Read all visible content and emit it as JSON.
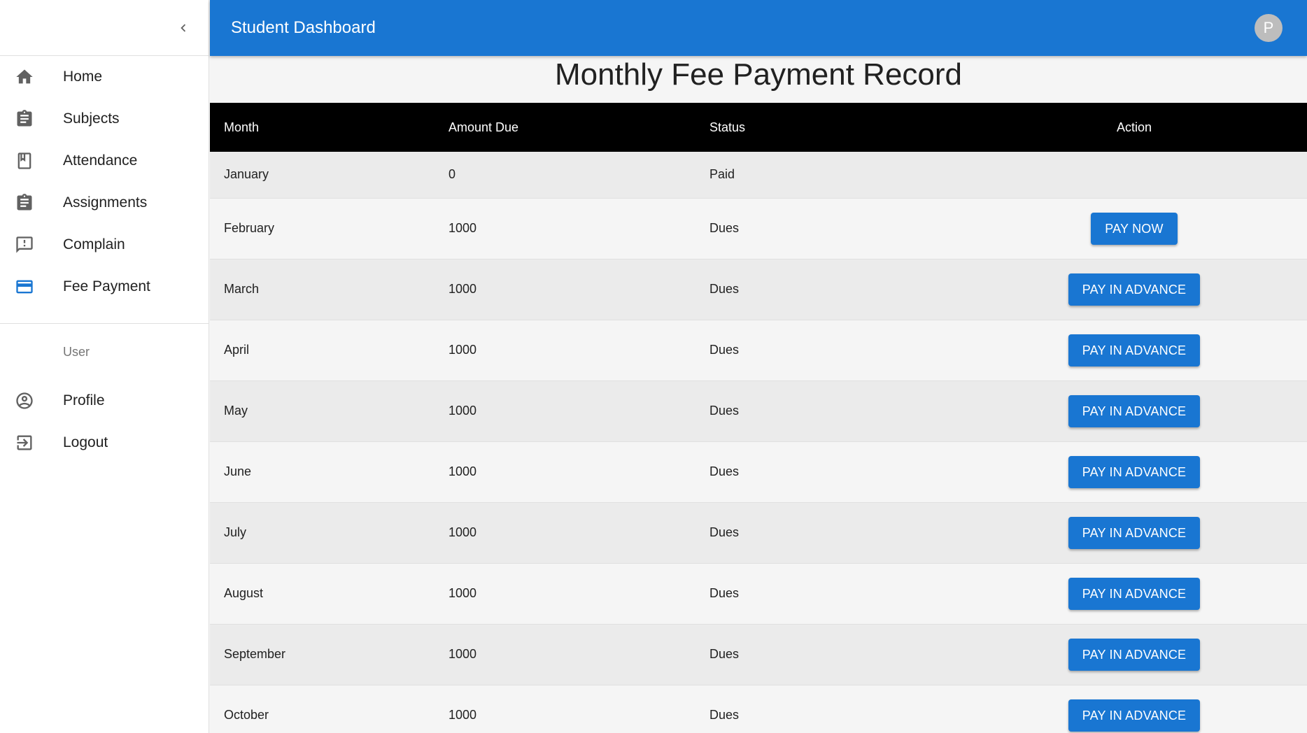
{
  "header": {
    "title": "Student Dashboard",
    "avatar_letter": "P"
  },
  "sidebar": {
    "items": [
      {
        "label": "Home",
        "icon": "home-icon"
      },
      {
        "label": "Subjects",
        "icon": "clipboard-icon"
      },
      {
        "label": "Attendance",
        "icon": "bookmark-book-icon"
      },
      {
        "label": "Assignments",
        "icon": "clipboard-icon"
      },
      {
        "label": "Complain",
        "icon": "feedback-icon"
      },
      {
        "label": "Fee Payment",
        "icon": "credit-card-icon",
        "active": true
      }
    ],
    "section_label": "User",
    "user_items": [
      {
        "label": "Profile",
        "icon": "account-circle-icon"
      },
      {
        "label": "Logout",
        "icon": "logout-icon"
      }
    ]
  },
  "main": {
    "title": "Monthly Fee Payment Record",
    "columns": [
      "Month",
      "Amount Due",
      "Status",
      "Action"
    ],
    "rows": [
      {
        "month": "January",
        "amount": "0",
        "status": "Paid",
        "action": ""
      },
      {
        "month": "February",
        "amount": "1000",
        "status": "Dues",
        "action": "PAY NOW"
      },
      {
        "month": "March",
        "amount": "1000",
        "status": "Dues",
        "action": "PAY IN ADVANCE"
      },
      {
        "month": "April",
        "amount": "1000",
        "status": "Dues",
        "action": "PAY IN ADVANCE"
      },
      {
        "month": "May",
        "amount": "1000",
        "status": "Dues",
        "action": "PAY IN ADVANCE"
      },
      {
        "month": "June",
        "amount": "1000",
        "status": "Dues",
        "action": "PAY IN ADVANCE"
      },
      {
        "month": "July",
        "amount": "1000",
        "status": "Dues",
        "action": "PAY IN ADVANCE"
      },
      {
        "month": "August",
        "amount": "1000",
        "status": "Dues",
        "action": "PAY IN ADVANCE"
      },
      {
        "month": "September",
        "amount": "1000",
        "status": "Dues",
        "action": "PAY IN ADVANCE"
      },
      {
        "month": "October",
        "amount": "1000",
        "status": "Dues",
        "action": "PAY IN ADVANCE"
      }
    ]
  },
  "colors": {
    "primary": "#1976d2",
    "table_header": "#000000",
    "icon_default": "#616161"
  }
}
